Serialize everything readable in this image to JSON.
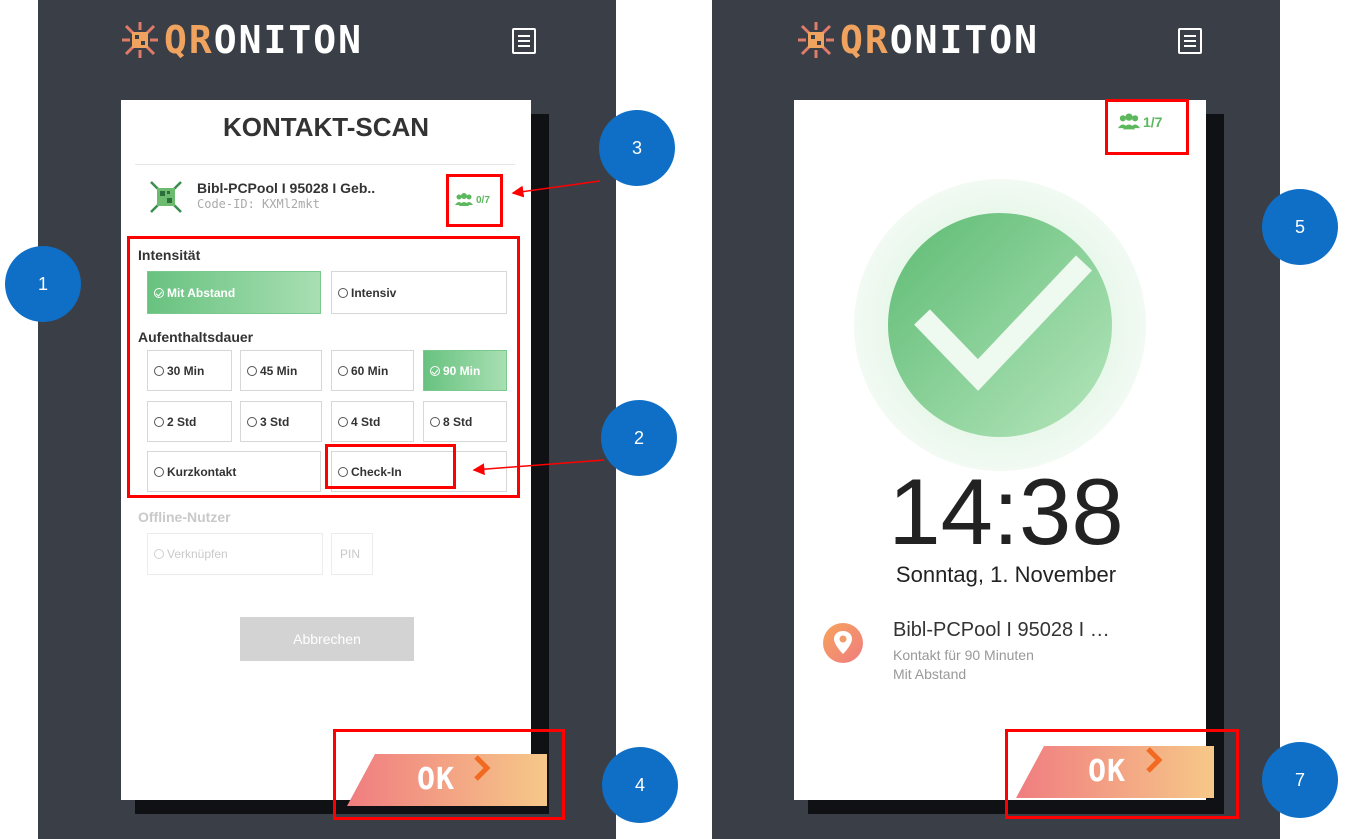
{
  "app": {
    "logo_prefix": "QR",
    "logo_rest": "ONITON"
  },
  "left_screen": {
    "title": "KONTAKT-SCAN",
    "location": {
      "name": "Bibl-PCPool I 95028 I Geb..",
      "code": "Code-ID: KXMl2mkt"
    },
    "count": "0/7",
    "intensity": {
      "label": "Intensität",
      "options": [
        {
          "label": "Mit Abstand",
          "selected": true
        },
        {
          "label": "Intensiv",
          "selected": false
        }
      ]
    },
    "duration": {
      "label": "Aufenthaltsdauer",
      "options": [
        {
          "label": "30 Min",
          "selected": false
        },
        {
          "label": "45 Min",
          "selected": false
        },
        {
          "label": "60 Min",
          "selected": false
        },
        {
          "label": "90 Min",
          "selected": true
        },
        {
          "label": "2 Std",
          "selected": false
        },
        {
          "label": "3 Std",
          "selected": false
        },
        {
          "label": "4 Std",
          "selected": false
        },
        {
          "label": "8 Std",
          "selected": false
        },
        {
          "label": "Kurzkontakt",
          "selected": false
        },
        {
          "label": "Check-In",
          "selected": false
        }
      ]
    },
    "offline": {
      "label": "Offline-Nutzer",
      "link_label": "Verknüpfen",
      "pin_label": "PIN"
    },
    "cancel_label": "Abbrechen",
    "ok_label": "OK"
  },
  "right_screen": {
    "count": "1/7",
    "time": "14:38",
    "date": "Sonntag, 1. November",
    "location_name": "Bibl-PCPool I 95028 I …",
    "contact_duration": "Kontakt für 90 Minuten",
    "intensity": "Mit Abstand",
    "ok_label": "OK"
  },
  "annotations": [
    "1",
    "2",
    "3",
    "4",
    "5",
    "7"
  ],
  "colors": {
    "background_dark": "#3a3f47",
    "accent_green": "#5cb85c",
    "logo_orange": "#f0a25f",
    "annotation_red": "#ff0000",
    "annotation_blue": "#0f6fc6"
  },
  "icons": [
    "qroniton-logo-icon",
    "menu-icon",
    "people-icon",
    "location-pin-icon",
    "checkmark-icon",
    "chevron-right-icon"
  ]
}
